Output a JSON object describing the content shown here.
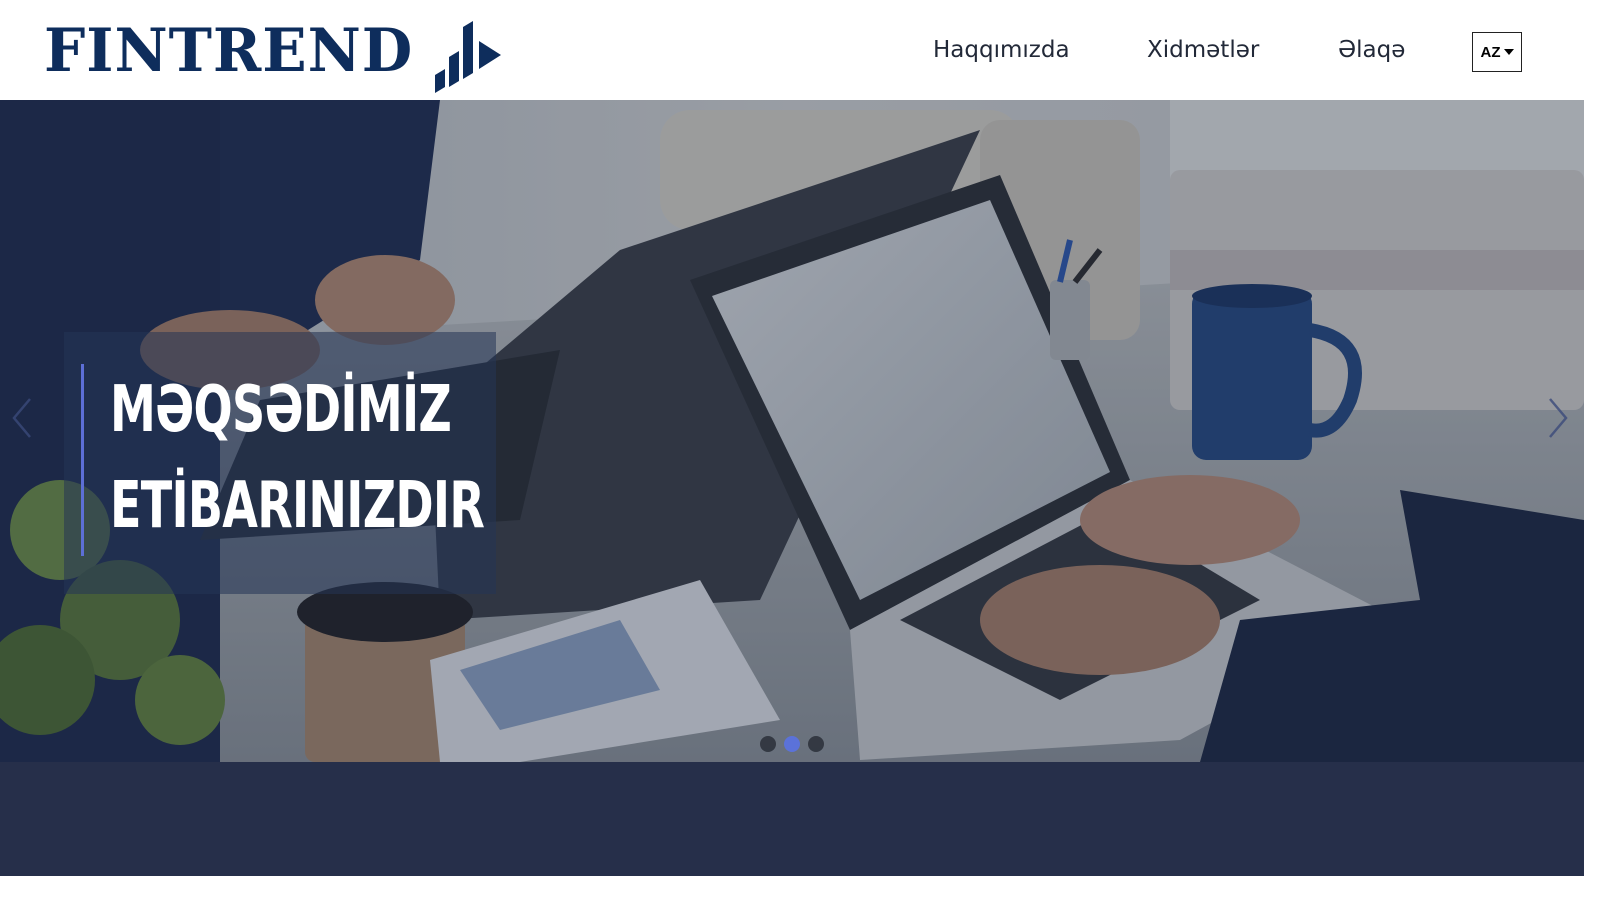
{
  "brand": {
    "name": "FINTREND",
    "color": "#0e2d5c",
    "logo_icon": "bar-chart-arrow-icon"
  },
  "nav": {
    "items": [
      {
        "label": "Haqqımızda"
      },
      {
        "label": "Xidmətlər"
      },
      {
        "label": "Əlaqə"
      }
    ],
    "language": {
      "selected": "AZ",
      "icon": "caret-down-icon"
    }
  },
  "hero": {
    "headline_line1": "MƏQSƏDİMİZ",
    "headline_line2": "ETİBARINIZDIR",
    "accent_color": "#5d6fd6",
    "prev_icon": "chevron-left-icon",
    "next_icon": "chevron-right-icon",
    "slides_total": 3,
    "active_slide": 2
  },
  "band": {
    "color": "#262f4a"
  }
}
